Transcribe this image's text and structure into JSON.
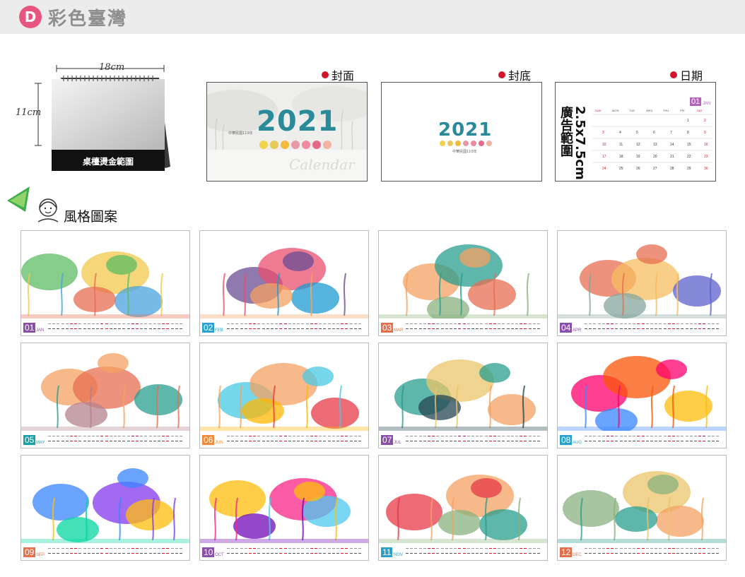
{
  "header": {
    "badge": "D",
    "title": "彩色臺灣"
  },
  "stand": {
    "width_label": "18cm",
    "height_label": "11cm",
    "area_label": "桌檯燙金範圍"
  },
  "sections": {
    "front": "封面",
    "back": "封底",
    "date": "日期",
    "style": "風格圖案"
  },
  "cover": {
    "year": "2021",
    "subtitle": "中華民國110年",
    "script": "Calendar"
  },
  "backcover": {
    "year": "2021",
    "subtitle": "中華民國110年"
  },
  "date_panel": {
    "ad_text": "2.5x7.5cm 廣告範圍",
    "month_num": "01",
    "month_name": "JAN",
    "weekdays": [
      "SUN",
      "MON",
      "TUE",
      "WED",
      "THU",
      "FRI",
      "SAT"
    ]
  },
  "months": [
    {
      "num": "01",
      "name": "JAN",
      "color": "#8a4fa8"
    },
    {
      "num": "02",
      "name": "FEB",
      "color": "#2aa0cf"
    },
    {
      "num": "03",
      "name": "MAR",
      "color": "#e3704a"
    },
    {
      "num": "04",
      "name": "APR",
      "color": "#8a4fa8"
    },
    {
      "num": "05",
      "name": "MAY",
      "color": "#1aa0a8"
    },
    {
      "num": "06",
      "name": "JUN",
      "color": "#f08a3a"
    },
    {
      "num": "07",
      "name": "JUL",
      "color": "#8a4fa8"
    },
    {
      "num": "08",
      "name": "AUG",
      "color": "#2aa0cf"
    },
    {
      "num": "09",
      "name": "SEP",
      "color": "#e3704a"
    },
    {
      "num": "10",
      "name": "OCT",
      "color": "#8a4fa8"
    },
    {
      "num": "11",
      "name": "NOV",
      "color": "#2aa0cf"
    },
    {
      "num": "12",
      "name": "DEC",
      "color": "#e3704a"
    }
  ],
  "colors": {
    "accent_pink": "#e8557f",
    "red_dot": "#d3152b",
    "year_teal": "#2a8a99"
  }
}
